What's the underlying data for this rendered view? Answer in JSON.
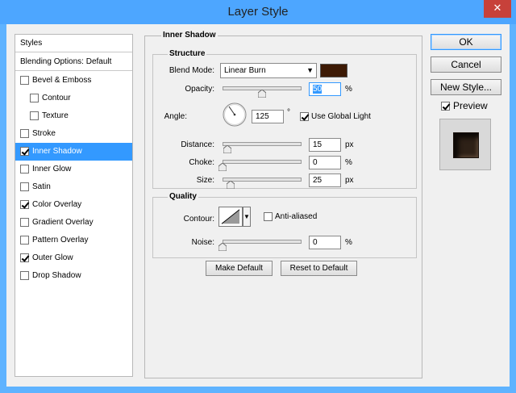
{
  "window": {
    "title": "Layer Style",
    "close_glyph": "✕"
  },
  "sidebar": {
    "styles_label": "Styles",
    "blending_label": "Blending Options: Default",
    "items": [
      {
        "label": "Bevel & Emboss",
        "checked": false,
        "indent": false,
        "selected": false
      },
      {
        "label": "Contour",
        "checked": false,
        "indent": true,
        "selected": false
      },
      {
        "label": "Texture",
        "checked": false,
        "indent": true,
        "selected": false
      },
      {
        "label": "Stroke",
        "checked": false,
        "indent": false,
        "selected": false
      },
      {
        "label": "Inner Shadow",
        "checked": true,
        "indent": false,
        "selected": true
      },
      {
        "label": "Inner Glow",
        "checked": false,
        "indent": false,
        "selected": false
      },
      {
        "label": "Satin",
        "checked": false,
        "indent": false,
        "selected": false
      },
      {
        "label": "Color Overlay",
        "checked": true,
        "indent": false,
        "selected": false
      },
      {
        "label": "Gradient Overlay",
        "checked": false,
        "indent": false,
        "selected": false
      },
      {
        "label": "Pattern Overlay",
        "checked": false,
        "indent": false,
        "selected": false
      },
      {
        "label": "Outer Glow",
        "checked": true,
        "indent": false,
        "selected": false
      },
      {
        "label": "Drop Shadow",
        "checked": false,
        "indent": false,
        "selected": false
      }
    ]
  },
  "panel": {
    "title": "Inner Shadow",
    "structure": {
      "title": "Structure",
      "blend_mode_label": "Blend Mode:",
      "blend_mode_value": "Linear Burn",
      "shadow_color": "#3d1a05",
      "opacity_label": "Opacity:",
      "opacity_value": "50",
      "opacity_level": 0.5,
      "percent": "%",
      "angle_label": "Angle:",
      "angle_value": "125",
      "degree": "°",
      "global_light_label": "Use Global Light",
      "global_light_checked": true,
      "distance_label": "Distance:",
      "distance_value": "15",
      "distance_level": 0.06,
      "px": "px",
      "choke_label": "Choke:",
      "choke_value": "0",
      "choke_level": 0,
      "size_label": "Size:",
      "size_value": "25",
      "size_level": 0.1
    },
    "quality": {
      "title": "Quality",
      "contour_label": "Contour:",
      "anti_aliased_label": "Anti-aliased",
      "anti_aliased_checked": false,
      "noise_label": "Noise:",
      "noise_value": "0",
      "noise_level": 0
    },
    "make_default": "Make Default",
    "reset_default": "Reset to Default"
  },
  "right": {
    "ok": "OK",
    "cancel": "Cancel",
    "new_style": "New Style...",
    "preview_label": "Preview",
    "preview_checked": true
  }
}
